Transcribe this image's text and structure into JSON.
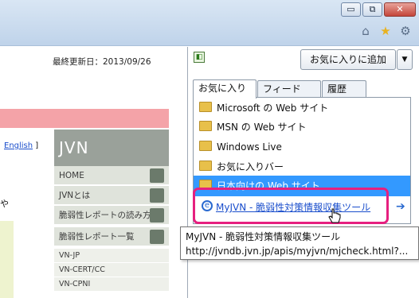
{
  "window": {
    "minimize_icon": "minimize-icon",
    "maximize_icon": "restore-icon",
    "close_icon": "close-icon",
    "minimize_glyph": "▭",
    "maximize_glyph": "⧉",
    "close_glyph": "✕"
  },
  "toolbar": {
    "home_glyph": "⌂",
    "favorites_glyph": "★",
    "tools_glyph": "⚙"
  },
  "page": {
    "last_updated": "最終更新日：2013/09/26",
    "lang_link": "English",
    "lang_bracket": "]",
    "side_text": "や",
    "section_title": "JVN",
    "nav": [
      {
        "label": "HOME"
      },
      {
        "label": "JVNとは"
      },
      {
        "label": "脆弱性レポートの読み方"
      },
      {
        "label": "脆弱性レポート一覧"
      }
    ],
    "subnav": [
      "VN-JP",
      "VN-CERT/CC",
      "VN-CPNI"
    ]
  },
  "favorites_pane": {
    "add_button": "お気に入りに追加",
    "dropdown_glyph": "▼",
    "pin_glyph": "◧",
    "tabs": [
      {
        "label": "お気に入り",
        "active": true
      },
      {
        "label": "フィード",
        "active": false
      },
      {
        "label": "履歴",
        "active": false
      }
    ],
    "items": [
      {
        "label": "Microsoft の Web サイト",
        "type": "folder"
      },
      {
        "label": "MSN の Web サイト",
        "type": "folder"
      },
      {
        "label": "Windows Live",
        "type": "folder"
      },
      {
        "label": "お気に入りバー",
        "type": "folder"
      },
      {
        "label": "日本向けの Web サイト",
        "type": "folder"
      }
    ],
    "hovered_link": {
      "label": "MyJVN - 脆弱性対策情報収集ツール",
      "go_glyph": "➔"
    },
    "tooltip": {
      "title": "MyJVN - 脆弱性対策情報収集ツール",
      "url": "http://jvndb.jvn.jp/apis/myjvn/mjcheck.html?..."
    }
  },
  "colors": {
    "selection": "#3399ff",
    "highlight_frame": "#e6207f",
    "jvn_header": "#9aa19a",
    "pink_bar": "#f4a3a8"
  }
}
